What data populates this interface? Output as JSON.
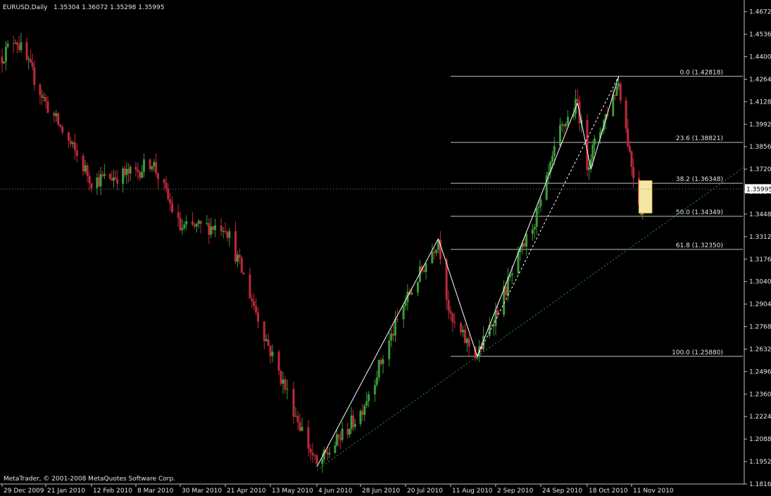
{
  "header": {
    "symbol": "EURUSD,Daily",
    "ohlc": "1.35304 1.36072 1.35298 1.35995"
  },
  "footer": {
    "copyright": "MetaTrader, © 2001-2008 MetaQuotes Software Corp."
  },
  "colors": {
    "background": "#000000",
    "axis": "#c0c0c0",
    "bull": "#3a9a3a",
    "bear": "#c0283a",
    "fib": "#bfbfbf",
    "trendline": "#2aa02a",
    "zigzag": "#ffffff",
    "rectangle": "#f3e7a3"
  },
  "chart_data": {
    "type": "candlestick",
    "title": "EURUSD,Daily",
    "ylim": [
      1.1816,
      1.4726
    ],
    "y_ticks": [
      "1.4672",
      "1.4536",
      "1.4400",
      "1.4264",
      "1.4128",
      "1.3992",
      "1.3856",
      "1.3720",
      "1.3584",
      "1.3448",
      "1.3312",
      "1.3176",
      "1.3040",
      "1.2904",
      "1.2768",
      "1.2632",
      "1.2496",
      "1.2360",
      "1.2224",
      "1.2088",
      "1.1952",
      "1.1816"
    ],
    "current_price": "1.35995",
    "x_ticks": [
      "29 Dec 2009",
      "21 Jan 2010",
      "12 Feb 2010",
      "8 Mar 2010",
      "30 Mar 2010",
      "21 Apr 2010",
      "13 May 2010",
      "4 Jun 2010",
      "28 Jun 2010",
      "20 Jul 2010",
      "11 Aug 2010",
      "2 Sep 2010",
      "24 Sep 2010",
      "18 Oct 2010",
      "11 Nov 2010"
    ],
    "price_path": [
      {
        "date": "29 Dec 2009",
        "price": 1.44
      },
      {
        "date": "5 Jan 2010",
        "price": 1.452
      },
      {
        "date": "21 Jan 2010",
        "price": 1.412
      },
      {
        "date": "12 Feb 2010",
        "price": 1.365
      },
      {
        "date": "8 Mar 2010",
        "price": 1.37
      },
      {
        "date": "16 Mar 2010",
        "price": 1.377
      },
      {
        "date": "30 Mar 2010",
        "price": 1.336
      },
      {
        "date": "21 Apr 2010",
        "price": 1.338
      },
      {
        "date": "13 May 2010",
        "price": 1.262
      },
      {
        "date": "4 Jun 2010",
        "price": 1.192
      },
      {
        "date": "28 Jun 2010",
        "price": 1.225
      },
      {
        "date": "20 Jul 2010",
        "price": 1.292
      },
      {
        "date": "5 Aug 2010",
        "price": 1.33
      },
      {
        "date": "11 Aug 2010",
        "price": 1.28
      },
      {
        "date": "24 Aug 2010",
        "price": 1.259
      },
      {
        "date": "2 Sep 2010",
        "price": 1.285
      },
      {
        "date": "24 Sep 2010",
        "price": 1.35
      },
      {
        "date": "4 Oct 2010",
        "price": 1.395
      },
      {
        "date": "13 Oct 2010",
        "price": 1.412
      },
      {
        "date": "18 Oct 2010",
        "price": 1.375
      },
      {
        "date": "4 Nov 2010",
        "price": 1.425
      },
      {
        "date": "11 Nov 2010",
        "price": 1.375
      },
      {
        "date": "16 Nov 2010",
        "price": 1.348
      },
      {
        "date": "19 Nov 2010",
        "price": 1.36
      }
    ],
    "fibonacci": {
      "levels": [
        {
          "label": "0.0 (1.42818)",
          "price": 1.42818
        },
        {
          "label": "23.6 (1.38821)",
          "price": 1.38821
        },
        {
          "label": "38.2 (1.36348)",
          "price": 1.36348
        },
        {
          "label": "50.0 (1.34349)",
          "price": 1.34349
        },
        {
          "label": "61.8 (1.32350)",
          "price": 1.3235
        },
        {
          "label": "100.0 (1.25880)",
          "price": 1.2588
        }
      ]
    }
  }
}
